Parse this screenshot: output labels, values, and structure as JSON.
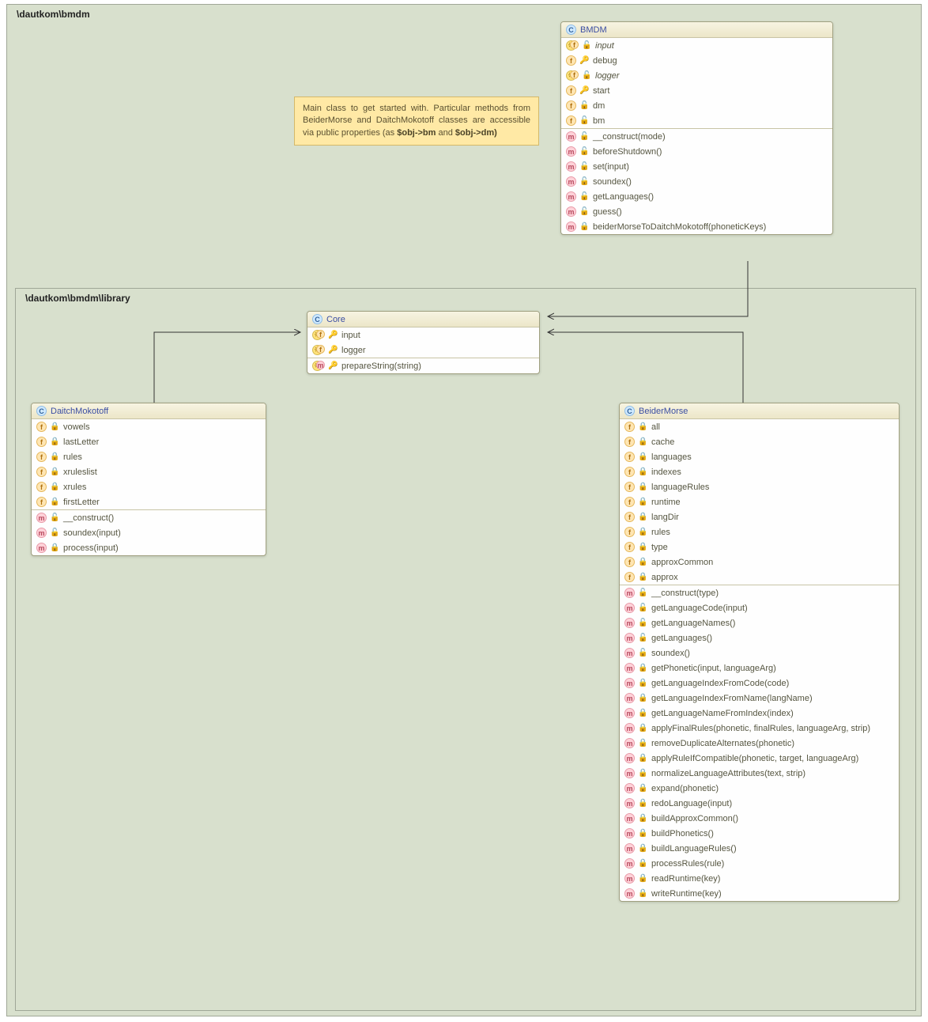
{
  "packages": {
    "outer": "\\dautkom\\bmdm",
    "inner": "\\dautkom\\bmdm\\library"
  },
  "note": {
    "text_before": "Main class to get started with. Particular methods from BeiderMorse and DaitchMokotoff classes are accessible via public properties (as ",
    "bold1": "$obj->bm",
    "mid": " and ",
    "bold2": "$obj->dm)"
  },
  "classes": {
    "bmdm": {
      "name": "BMDM",
      "fields": [
        {
          "kind": "keyf",
          "vis": "public",
          "label": "input",
          "italic": true
        },
        {
          "kind": "f",
          "vis": "protected",
          "label": "debug"
        },
        {
          "kind": "keyf",
          "vis": "public",
          "label": "logger",
          "italic": true
        },
        {
          "kind": "f",
          "vis": "protected",
          "label": "start"
        },
        {
          "kind": "f",
          "vis": "public",
          "label": "dm"
        },
        {
          "kind": "f",
          "vis": "public",
          "label": "bm"
        }
      ],
      "methods": [
        {
          "kind": "m",
          "vis": "public",
          "label": "__construct(mode)"
        },
        {
          "kind": "m",
          "vis": "public",
          "label": "beforeShutdown()"
        },
        {
          "kind": "m",
          "vis": "public",
          "label": "set(input)"
        },
        {
          "kind": "m",
          "vis": "public",
          "label": "soundex()"
        },
        {
          "kind": "m",
          "vis": "public",
          "label": "getLanguages()"
        },
        {
          "kind": "m",
          "vis": "public",
          "label": "guess()"
        },
        {
          "kind": "m",
          "vis": "private",
          "label": "beiderMorseToDaitchMokotoff(phoneticKeys)"
        }
      ]
    },
    "core": {
      "name": "Core",
      "fields": [
        {
          "kind": "keyf",
          "vis": "protected",
          "label": "input"
        },
        {
          "kind": "keyf",
          "vis": "protected",
          "label": "logger"
        }
      ],
      "methods": [
        {
          "kind": "keym",
          "vis": "protected",
          "label": "prepareString(string)"
        }
      ]
    },
    "daitch": {
      "name": "DaitchMokotoff",
      "fields": [
        {
          "kind": "f",
          "vis": "private",
          "label": "vowels"
        },
        {
          "kind": "f",
          "vis": "private",
          "label": "lastLetter"
        },
        {
          "kind": "f",
          "vis": "private",
          "label": "rules"
        },
        {
          "kind": "f",
          "vis": "private",
          "label": "xruleslist"
        },
        {
          "kind": "f",
          "vis": "private",
          "label": "xrules"
        },
        {
          "kind": "f",
          "vis": "private",
          "label": "firstLetter"
        }
      ],
      "methods": [
        {
          "kind": "m",
          "vis": "public",
          "label": "__construct()"
        },
        {
          "kind": "m",
          "vis": "public",
          "label": "soundex(input)"
        },
        {
          "kind": "m",
          "vis": "private",
          "label": "process(input)"
        }
      ]
    },
    "beider": {
      "name": "BeiderMorse",
      "fields": [
        {
          "kind": "f",
          "vis": "private",
          "label": "all"
        },
        {
          "kind": "f",
          "vis": "private",
          "label": "cache"
        },
        {
          "kind": "f",
          "vis": "private",
          "label": "languages"
        },
        {
          "kind": "f",
          "vis": "private",
          "label": "indexes"
        },
        {
          "kind": "f",
          "vis": "private",
          "label": "languageRules"
        },
        {
          "kind": "f",
          "vis": "private",
          "label": "runtime"
        },
        {
          "kind": "f",
          "vis": "private",
          "label": "langDir"
        },
        {
          "kind": "f",
          "vis": "private",
          "label": "rules"
        },
        {
          "kind": "f",
          "vis": "private",
          "label": "type"
        },
        {
          "kind": "f",
          "vis": "private",
          "label": "approxCommon"
        },
        {
          "kind": "f",
          "vis": "private",
          "label": "approx"
        }
      ],
      "methods": [
        {
          "kind": "m",
          "vis": "public",
          "label": "__construct(type)"
        },
        {
          "kind": "m",
          "vis": "public",
          "label": "getLanguageCode(input)"
        },
        {
          "kind": "m",
          "vis": "public",
          "label": "getLanguageNames()"
        },
        {
          "kind": "m",
          "vis": "public",
          "label": "getLanguages()"
        },
        {
          "kind": "m",
          "vis": "public",
          "label": "soundex()"
        },
        {
          "kind": "m",
          "vis": "private",
          "label": "getPhonetic(input, languageArg)"
        },
        {
          "kind": "m",
          "vis": "private",
          "label": "getLanguageIndexFromCode(code)"
        },
        {
          "kind": "m",
          "vis": "private",
          "label": "getLanguageIndexFromName(langName)"
        },
        {
          "kind": "m",
          "vis": "private",
          "label": "getLanguageNameFromIndex(index)"
        },
        {
          "kind": "m",
          "vis": "private",
          "label": "applyFinalRules(phonetic, finalRules, languageArg, strip)"
        },
        {
          "kind": "m",
          "vis": "private",
          "label": "removeDuplicateAlternates(phonetic)"
        },
        {
          "kind": "m",
          "vis": "private",
          "label": "applyRuleIfCompatible(phonetic, target, languageArg)"
        },
        {
          "kind": "m",
          "vis": "private",
          "label": "normalizeLanguageAttributes(text, strip)"
        },
        {
          "kind": "m",
          "vis": "private",
          "label": "expand(phonetic)"
        },
        {
          "kind": "m",
          "vis": "private",
          "label": "redoLanguage(input)"
        },
        {
          "kind": "m",
          "vis": "private",
          "label": "buildApproxCommon()"
        },
        {
          "kind": "m",
          "vis": "private",
          "label": "buildPhonetics()"
        },
        {
          "kind": "m",
          "vis": "private",
          "label": "buildLanguageRules()"
        },
        {
          "kind": "m",
          "vis": "private",
          "label": "processRules(rule)"
        },
        {
          "kind": "m",
          "vis": "private",
          "label": "readRuntime(key)"
        },
        {
          "kind": "m",
          "vis": "private",
          "label": "writeRuntime(key)"
        }
      ]
    }
  }
}
